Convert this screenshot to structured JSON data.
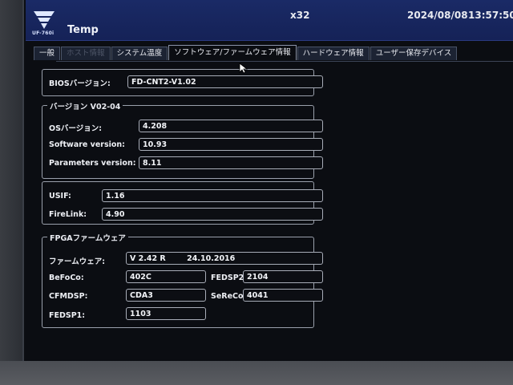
{
  "header": {
    "logo_text": "UF-760i",
    "title": "Temp",
    "zoom": "x32",
    "date": "2024/08/08",
    "time": "13:57:50"
  },
  "tabs": [
    {
      "label": "一般"
    },
    {
      "label": "ホスト情報"
    },
    {
      "label": "システム温度"
    },
    {
      "label": "ソフトウェア/ファームウェア情報"
    },
    {
      "label": "ハードウェア情報"
    },
    {
      "label": "ユーザー保存デバイス"
    }
  ],
  "bios": {
    "label": "BIOSバージョン:",
    "value": "FD-CNT2-V1.02"
  },
  "version_group": {
    "legend": "バージョン V02-04",
    "rows": [
      {
        "label": "OSバージョン:",
        "value": "4.208"
      },
      {
        "label": "Software version:",
        "value": "10.93"
      },
      {
        "label": "Parameters version:",
        "value": "8.11"
      }
    ]
  },
  "usif": {
    "label": "USIF:",
    "value": "1.16"
  },
  "firelink": {
    "label": "FireLink:",
    "value": "4.90"
  },
  "fpga": {
    "legend": "FPGAファームウェア",
    "firmware_label": "ファームウェア:",
    "firmware_value": "V 2.42 R        24.10.2016",
    "befoco_label": "BeFoCo:",
    "befoco_value": "402C",
    "fedsp2_label": "FEDSP2:",
    "fedsp2_value": "2104",
    "cfmdsp_label": "CFMDSP:",
    "cfmdsp_value": "CDA3",
    "sereco_label": "SeReCo:",
    "sereco_value": "4041",
    "fedsp1_label": "FEDSP1:",
    "fedsp1_value": "1103"
  }
}
